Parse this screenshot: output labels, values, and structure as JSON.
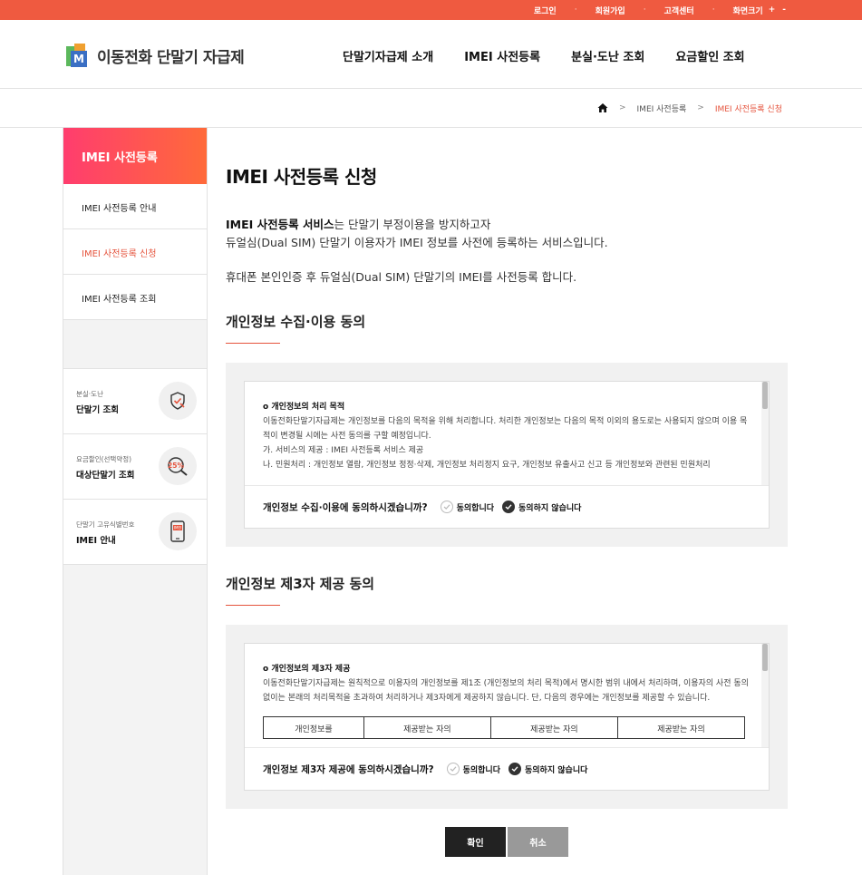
{
  "topbar": {
    "login": "로그인",
    "join": "회원가입",
    "support": "고객센터",
    "font_size": "화면크기",
    "plus": "+",
    "minus": "-"
  },
  "header": {
    "logo_text": "이동전화 단말기 자급제",
    "logo_letter": "M",
    "nav": [
      "단말기자급제 소개",
      "IMEI 사전등록",
      "분실·도난 조회",
      "요금할인 조회"
    ]
  },
  "breadcrumb": {
    "sep": ">",
    "items": [
      "IMEI 사전등록",
      "IMEI 사전등록 신청"
    ]
  },
  "sidebar": {
    "title": "IMEI 사전등록",
    "items": [
      {
        "label": "IMEI 사전등록 안내"
      },
      {
        "label": "IMEI 사전등록 신청"
      },
      {
        "label": "IMEI 사전등록 조회"
      }
    ],
    "active_index": 1,
    "quick": [
      {
        "small": "분실·도난",
        "big": "단말기 조회",
        "icon": "shield-check-icon"
      },
      {
        "small": "요금할인(선택약정)",
        "big": "대상단말기 조회",
        "icon": "discount-search-icon",
        "badge": "25%"
      },
      {
        "small": "단말기 고유식별번호",
        "big": "IMEI 안내",
        "icon": "phone-imei-icon",
        "badge": "IMEI"
      }
    ]
  },
  "main": {
    "title": "IMEI 사전등록 신청",
    "intro_bold": "IMEI 사전등록 서비스",
    "intro_rest": "는 단말기 부정이용을 방지하고자",
    "intro_line2": "듀얼심(Dual SIM) 단말기 이용자가 IMEI 정보를 사전에 등록하는 서비스입니다.",
    "intro_line3": "휴대폰 본인인증 후 듀얼심(Dual SIM) 단말기의 IMEI를 사전등록 합니다.",
    "section1": {
      "title": "개인정보 수집·이용 동의",
      "terms_title": "o 개인정보의 처리 목적",
      "terms_body": "이동전화단말기자급제는 개인정보를 다음의 목적을 위해 처리합니다. 처리한 개인정보는 다음의 목적 이외의 용도로는 사용되지 않으며 이용 목적이 변경될 시에는 사전 동의를 구할 예정입니다.",
      "terms_item1": "가. 서비스의 제공 : IMEI 사전등록 서비스 제공",
      "terms_item2": "나. 민원처리 : 개인정보 열람, 개인정보 정정·삭제, 개인정보 처리정지 요구, 개인정보 유출사고 신고 등 개인정보와 관련된 민원처리",
      "question": "개인정보 수집·이용에 동의하시겠습니까?",
      "agree": "동의합니다",
      "disagree": "동의하지 않습니다",
      "selected": "disagree"
    },
    "section2": {
      "title": "개인정보 제3자 제공 동의",
      "terms_title": "o 개인정보의 제3자 제공",
      "terms_body": "이동전화단말기자급제는 원칙적으로 이용자의 개인정보를 제1조 (개인정보의 처리 목적)에서 명시한 범위 내에서 처리하며, 이용자의 사전 동의 없이는 본래의 처리목적을 초과하여 처리하거나 제3자에게 제공하지 않습니다. 단, 다음의 경우에는 개인정보를 제공할 수 있습니다.",
      "table_headers": [
        "개인정보를",
        "제공받는 자의",
        "제공받는 자의",
        "제공받는 자의"
      ],
      "question": "개인정보 제3자 제공에 동의하시겠습니까?",
      "agree": "동의합니다",
      "disagree": "동의하지 않습니다",
      "selected": "disagree"
    },
    "buttons": {
      "ok": "확인",
      "cancel": "취소"
    }
  }
}
